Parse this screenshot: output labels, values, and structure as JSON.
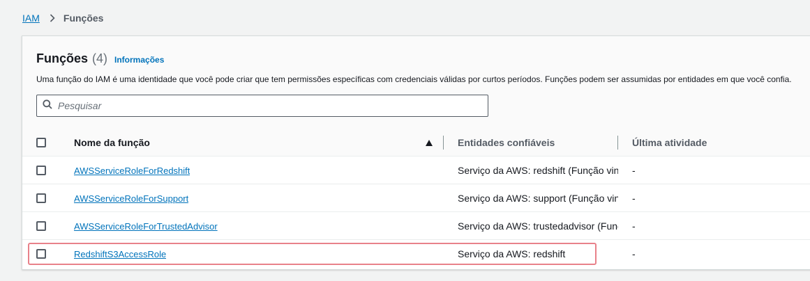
{
  "breadcrumb": {
    "root": "IAM",
    "current": "Funções"
  },
  "panel": {
    "title": "Funções",
    "count": "(4)",
    "info_link": "Informações",
    "description": "Uma função do IAM é uma identidade que você pode criar que tem permissões específicas com credenciais válidas por curtos períodos. Funções podem ser assumidas por entidades em que você confia.",
    "search_placeholder": "Pesquisar"
  },
  "table": {
    "columns": {
      "name": "Nome da função",
      "trusted": "Entidades confiáveis",
      "last_activity": "Última atividade"
    },
    "sort_icon": "triangle-up-icon",
    "rows": [
      {
        "name": "AWSServiceRoleForRedshift",
        "trusted": "Serviço da AWS: redshift (Função vin",
        "last": "-"
      },
      {
        "name": "AWSServiceRoleForSupport",
        "trusted": "Serviço da AWS: support (Função vin",
        "last": "-"
      },
      {
        "name": "AWSServiceRoleForTrustedAdvisor",
        "trusted": "Serviço da AWS: trustedadvisor (Func",
        "last": "-"
      },
      {
        "name": "RedshiftS3AccessRole",
        "trusted": "Serviço da AWS: redshift",
        "last": "-"
      }
    ]
  },
  "colors": {
    "link": "#0073bb",
    "highlight": "#e8818a"
  }
}
